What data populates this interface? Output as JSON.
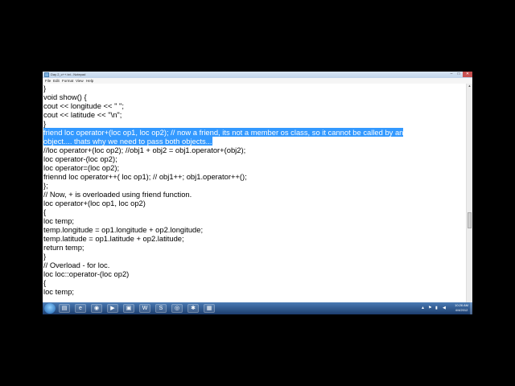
{
  "window": {
    "title": "Day 2_c++.txt - Notepad",
    "min": "–",
    "max": "□",
    "close": "✕"
  },
  "menu": [
    "File",
    "Edit",
    "Format",
    "View",
    "Help"
  ],
  "code": {
    "lines_before": [
      "}",
      "void show() {",
      "cout << longitude << \" \";",
      "cout << latitude << \"\\n\";",
      "}"
    ],
    "selected": [
      "friend loc operator+(loc op1, loc op2); // now a friend, its not a member os class, so it cannot be called by an",
      "object.... thats why we need to pass both objects..."
    ],
    "lines_after": [
      "//loc operator+(loc op2); //obj1 + obj2 = obj1.operator+(obj2);",
      "loc operator-(loc op2);",
      "loc operator=(loc op2);",
      "friennd loc operator++( loc op1); // obj1++; obj1.operator++();",
      "};",
      "// Now, + is overloaded using friend function.",
      "loc operator+(loc op1, loc op2)",
      "{",
      "loc temp;",
      "temp.longitude = op1.longitude + op2.longitude;",
      "temp.latitude = op1.latitude + op2.latitude;",
      "return temp;",
      "}",
      "// Overload - for loc.",
      "loc loc::operator-(loc op2)",
      "{",
      "loc temp;"
    ]
  },
  "taskbar": {
    "icons": [
      "folder",
      "ie",
      "chrome",
      "media",
      "explorer",
      "word",
      "skype",
      "lens",
      "gear",
      "paint"
    ],
    "clock_time": "10:26 AM",
    "clock_date": "4/4/2012"
  }
}
